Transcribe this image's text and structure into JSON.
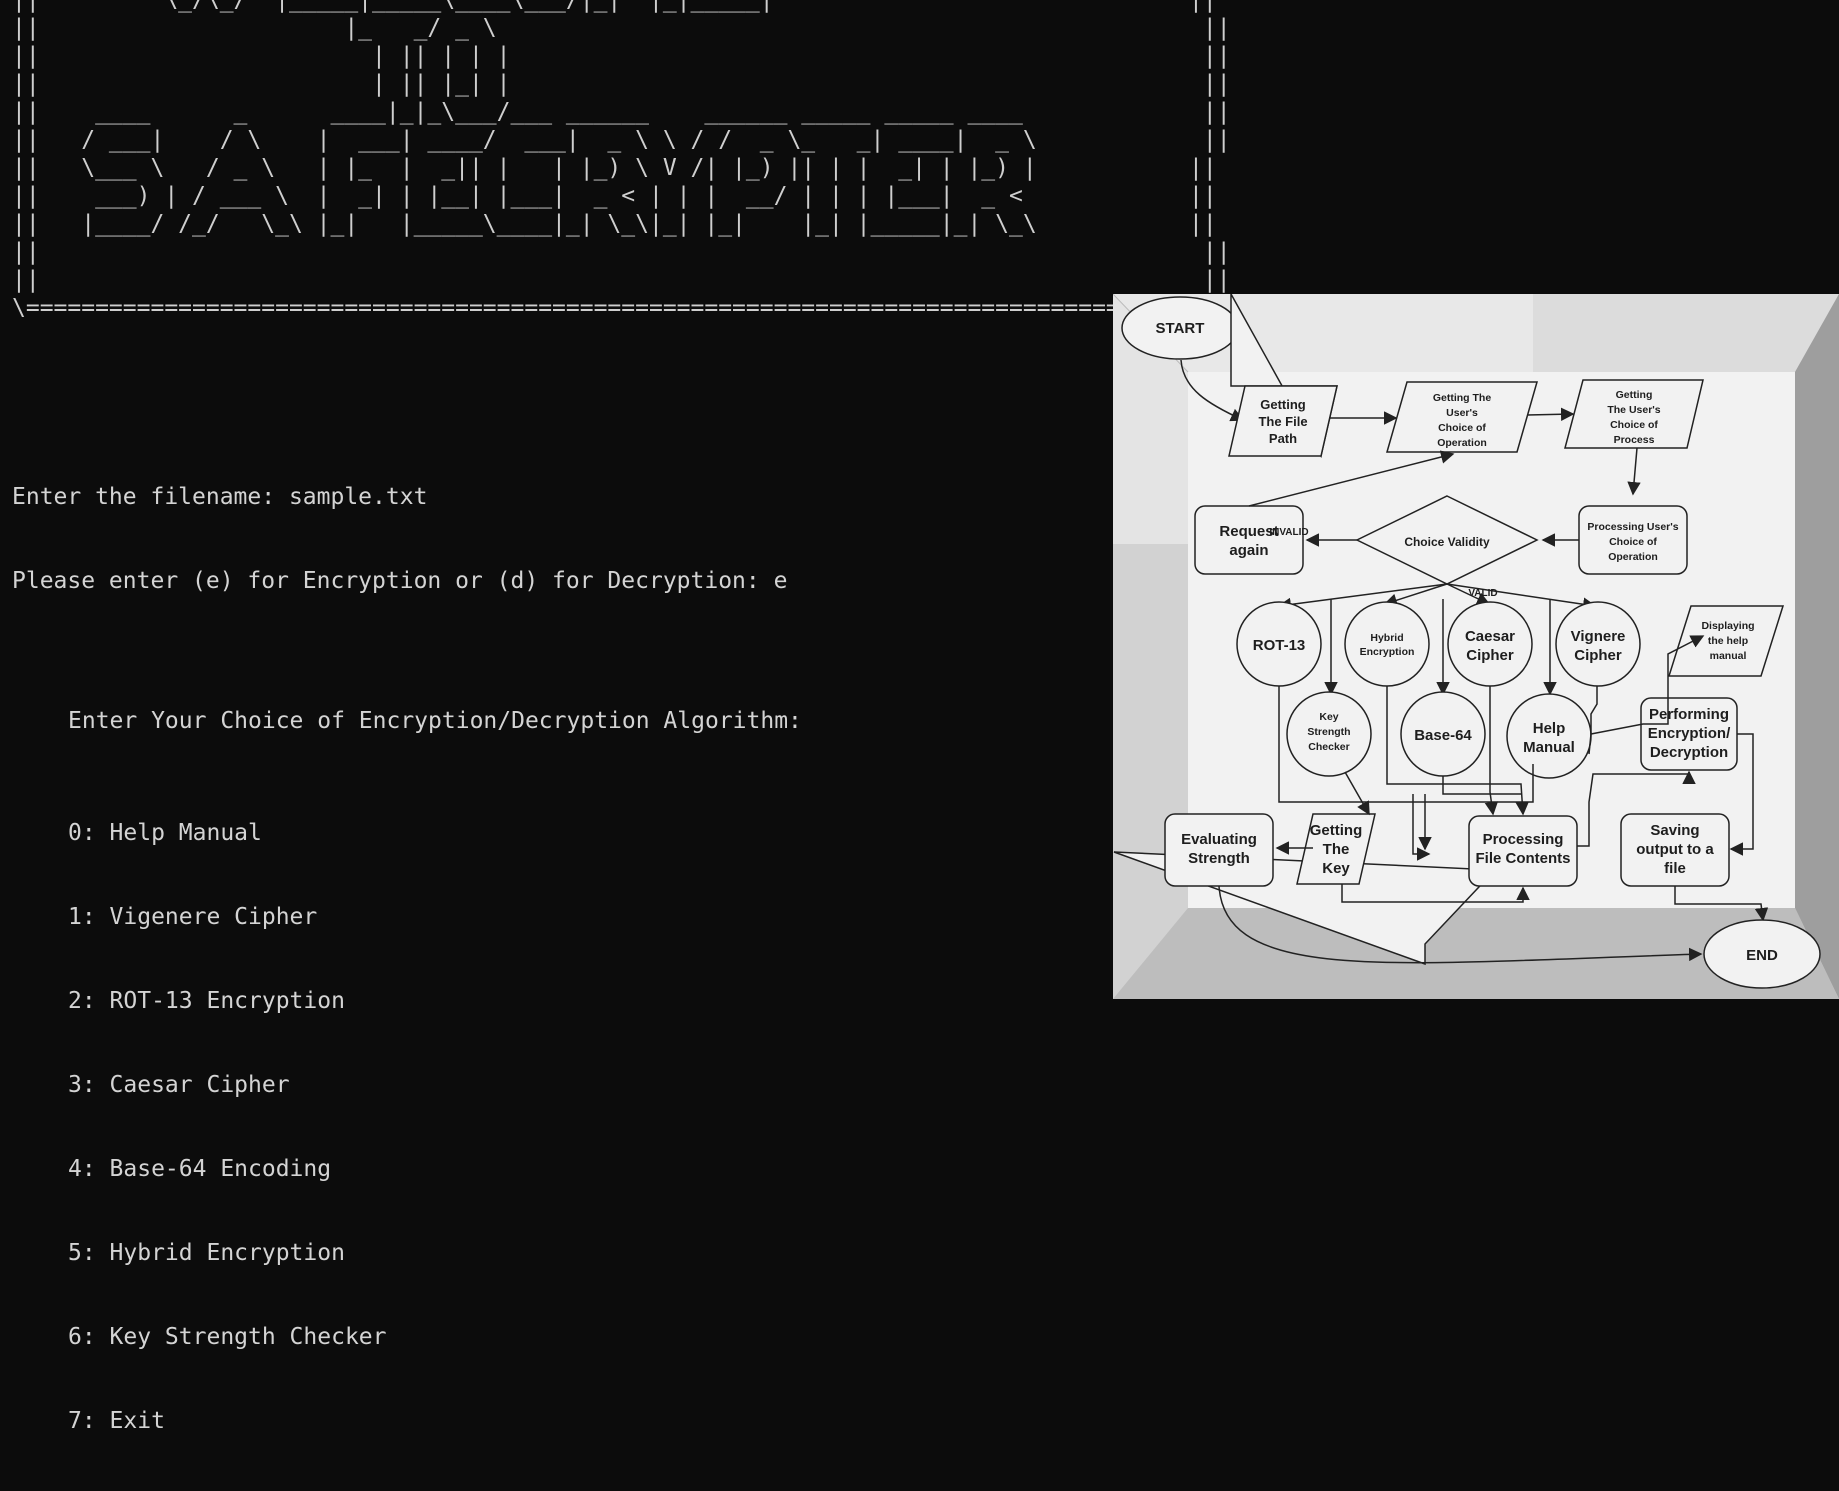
{
  "terminal": {
    "banner_lines": [
      "||         \\_/\\_/  |_____|_____\\____\\___/|_|  |_|_____|                              ||",
      "||                      |_   _/ _ \\                                                   ||",
      "||                        | || | | |                                                  ||",
      "||                        | || |_| |                                                  ||",
      "||    ____      _      ____|_|_\\___/___ ______    ______ _____ _____ ____             ||",
      "||   / ___|    / \\    |  ___| ____/  ___|  _ \\ \\ / /  _ \\_   _| ____|  _ \\            ||",
      "||   \\___ \\   / _ \\   | |_  |  _|| |   | |_) \\ V /| |_) || | |  _| | |_) |           ||",
      "||    ___) | / ___ \\  |  _| | |__| |___|  _ < | | |  __/ | | | |___|  _ <            ||",
      "||   |____/ /_/   \\_\\ |_|   |_____\\____|_| \\_\\|_| |_|    |_| |_____|_| \\_\\           ||",
      "||                                                                                    ||",
      "||                                                                                    ||",
      "\\====================================================================================/"
    ],
    "filename_prompt": "Enter the filename: sample.txt",
    "mode_prompt": "Please enter (e) for Encryption or (d) for Decryption: e",
    "algorithm_prompt": "Enter Your Choice of Encryption/Decryption Algorithm:",
    "menu_items": [
      "0: Help Manual",
      "1: Vigenere Cipher",
      "2: ROT-13 Encryption",
      "3: Caesar Cipher",
      "4: Base-64 Encoding",
      "5: Hybrid Encryption",
      "6: Key Strength Checker",
      "7: Exit"
    ]
  },
  "flowchart": {
    "start": "START",
    "end": "END",
    "get_file_path": [
      "Getting",
      "The File",
      "Path"
    ],
    "get_operation": [
      "Getting The",
      "User's",
      "Choice of",
      "Operation"
    ],
    "get_process": [
      "Getting",
      "The User's",
      "Choice of",
      "Process"
    ],
    "request_again": [
      "Request",
      "again"
    ],
    "invalid": "INVALID",
    "choice_validity": "Choice Validity",
    "valid": "VALID",
    "processing_choice": [
      "Processing User's",
      "Choice of",
      "Operation"
    ],
    "rot13": "ROT-13",
    "hybrid": [
      "Hybrid",
      "Encryption"
    ],
    "caesar": [
      "Caesar",
      "Cipher"
    ],
    "vignere": [
      "Vignere",
      "Cipher"
    ],
    "help_display": [
      "Displaying",
      "the help",
      "manual"
    ],
    "key_strength": [
      "Key",
      "Strength",
      "Checker"
    ],
    "base64": "Base-64",
    "help_manual": [
      "Help",
      "Manual"
    ],
    "performing": [
      "Performing",
      "Encryption/",
      "Decryption"
    ],
    "evaluating": [
      "Evaluating",
      "Strength"
    ],
    "getting_key": [
      "Getting",
      "The",
      "Key"
    ],
    "processing_file": [
      "Processing",
      "File Contents"
    ],
    "saving": [
      "Saving",
      "output to a",
      "file"
    ]
  }
}
